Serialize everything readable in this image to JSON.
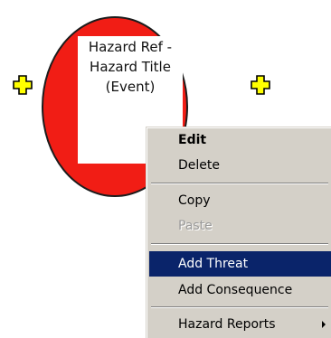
{
  "node": {
    "label_lines": [
      "Hazard Ref -",
      "Hazard Title",
      "(Event)"
    ]
  },
  "context_menu": {
    "items": [
      {
        "label": "Edit",
        "style": "bold"
      },
      {
        "label": "Delete",
        "style": "normal"
      },
      {
        "label": "Copy",
        "style": "normal"
      },
      {
        "label": "Paste",
        "style": "disabled"
      },
      {
        "label": "Add Threat",
        "style": "highlighted"
      },
      {
        "label": "Add Consequence",
        "style": "normal"
      },
      {
        "label": "Hazard Reports",
        "style": "submenu"
      }
    ]
  },
  "colors": {
    "hazard_ring": "#f11d15",
    "connector_fill": "#ffff00",
    "menu_highlight": "#0a246a",
    "menu_background": "#d4d0c8"
  },
  "icons": [
    "add-connector-icon",
    "submenu-arrow-icon"
  ]
}
